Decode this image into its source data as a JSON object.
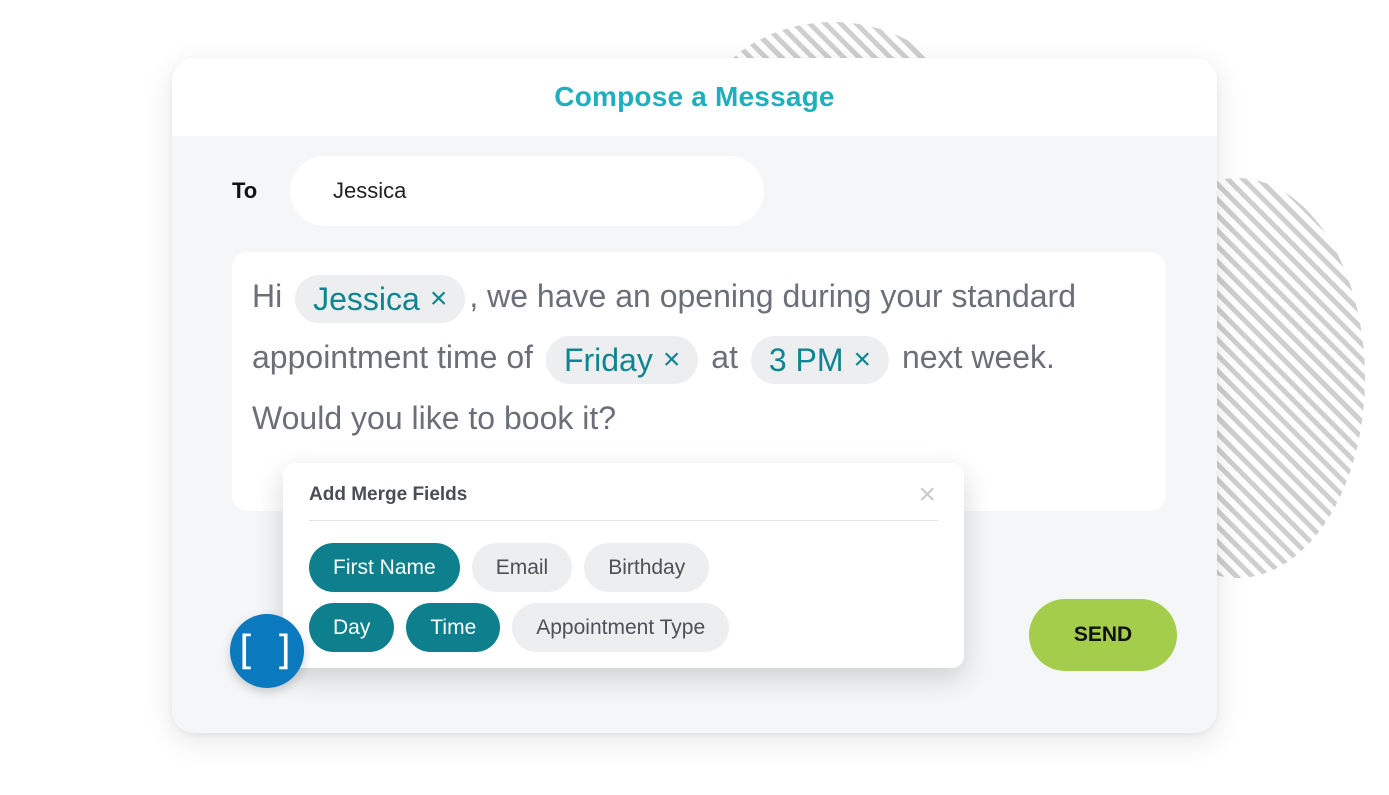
{
  "header": {
    "title": "Compose a Message"
  },
  "recipient": {
    "label": "To",
    "value": "Jessica"
  },
  "message": {
    "segments": [
      {
        "type": "text",
        "value": "Hi"
      },
      {
        "type": "chip",
        "value": "Jessica",
        "remove_icon": "×"
      },
      {
        "type": "text",
        "value": ", we have an opening during your standard"
      },
      {
        "type": "text",
        "value": "appointment time of"
      },
      {
        "type": "chip",
        "value": "Friday",
        "remove_icon": "×"
      },
      {
        "type": "text",
        "value": "at"
      },
      {
        "type": "chip",
        "value": "3 PM",
        "remove_icon": "×"
      },
      {
        "type": "text",
        "value": "next week."
      },
      {
        "type": "text",
        "value": "Would you like to book it?"
      }
    ]
  },
  "merge_fields": {
    "title": "Add Merge Fields",
    "close_icon": "×",
    "fields": [
      {
        "label": "First Name",
        "active": true
      },
      {
        "label": "Email",
        "active": false
      },
      {
        "label": "Birthday",
        "active": false
      },
      {
        "label": "Day",
        "active": true
      },
      {
        "label": "Time",
        "active": true
      },
      {
        "label": "Appointment Type",
        "active": false
      }
    ]
  },
  "merge_button": {
    "icon": "[ ]"
  },
  "send_button": {
    "label": "SEND"
  },
  "colors": {
    "title_accent": "#1fb0bd",
    "chip_text": "#0e8591",
    "active_field": "#0e7f8c",
    "merge_button": "#0a79bd",
    "send_button": "#a3cd4a"
  }
}
